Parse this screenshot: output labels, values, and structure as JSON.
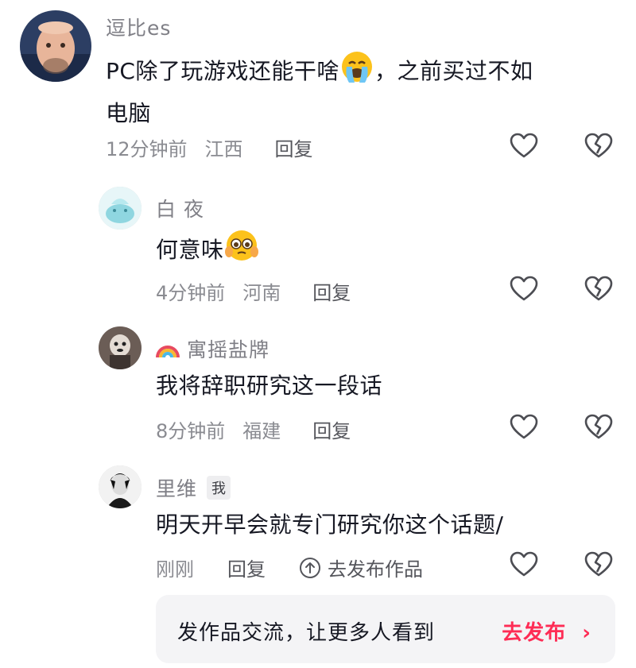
{
  "comments": [
    {
      "username": "逗比es",
      "text_before": "PC除了玩游戏还能干啥",
      "text_after": "，之前买过不如",
      "text_line2": "电脑",
      "emoji": "crying-face-emoji",
      "time": "12分钟前",
      "location": "江西",
      "reply": "回复"
    },
    {
      "username": "白 夜",
      "text": "何意味",
      "emoji": "pleading-face-emoji",
      "time": "4分钟前",
      "location": "河南",
      "reply": "回复"
    },
    {
      "username_icon": "rainbow-icon",
      "username": "寓摇盐牌",
      "text": "我将辞职研究这一段话",
      "time": "8分钟前",
      "location": "福建",
      "reply": "回复"
    },
    {
      "username": "里维",
      "badge": "我",
      "text": "明天开早会就专门研究你这个话题/",
      "time": "刚刚",
      "reply": "回复",
      "publish_works": "去发布作品"
    }
  ],
  "publish_bar": {
    "text": "发作品交流，让更多人看到",
    "button": "去发布",
    "chevron": "›"
  },
  "colors": {
    "accent": "#fe2c55",
    "meta": "#8a8b91",
    "username": "#7f7f86"
  },
  "icons": [
    "heart-icon",
    "broken-heart-icon",
    "upload-icon",
    "chevron-right-icon"
  ]
}
